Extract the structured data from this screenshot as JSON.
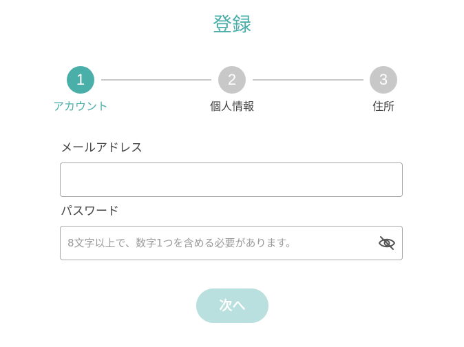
{
  "title": "登録",
  "stepper": {
    "steps": [
      {
        "number": "1",
        "label": "アカウント",
        "state": "active"
      },
      {
        "number": "2",
        "label": "個人情報",
        "state": "inactive"
      },
      {
        "number": "3",
        "label": "住所",
        "state": "inactive"
      }
    ]
  },
  "form": {
    "email": {
      "label": "メールアドレス",
      "value": "",
      "placeholder": ""
    },
    "password": {
      "label": "パスワード",
      "value": "",
      "placeholder": "8文字以上で、数字1つを含める必要があります。",
      "toggle_icon": "eye-slash-icon"
    }
  },
  "next_button": {
    "label": "次へ",
    "state": "disabled"
  },
  "colors": {
    "accent": "#4aaea9",
    "inactive": "#c8c8c8",
    "button_disabled": "#b9e0de",
    "text": "#444444"
  }
}
